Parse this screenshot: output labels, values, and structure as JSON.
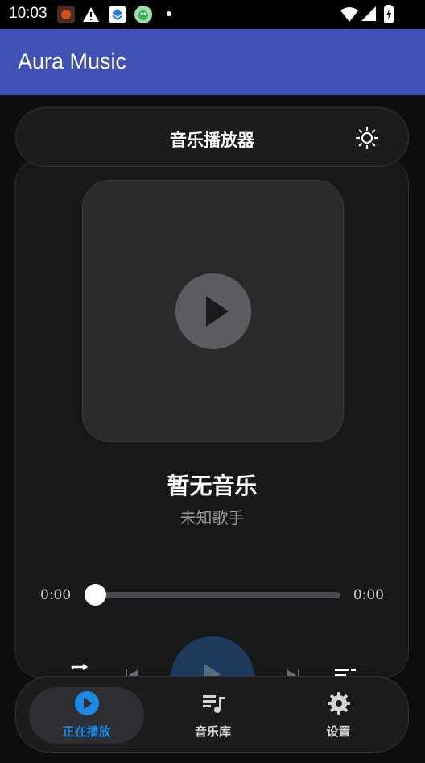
{
  "status_bar": {
    "time": "10:03"
  },
  "app_bar": {
    "title": "Aura Music"
  },
  "header": {
    "title": "音乐播放器",
    "theme_icon": "sun-icon"
  },
  "player": {
    "song_title": "暂无音乐",
    "artist": "未知歌手",
    "time_current": "0:00",
    "time_total": "0:00",
    "progress": 0
  },
  "controls": {
    "repeat_icon": "repeat-icon",
    "prev_icon": "skip-previous-icon",
    "play_icon": "play-icon",
    "next_icon": "skip-next-icon",
    "queue_icon": "queue-music-icon"
  },
  "bottom_nav": {
    "items": [
      {
        "label": "正在播放",
        "icon": "play-circle-icon",
        "active": true
      },
      {
        "label": "音乐库",
        "icon": "library-music-icon",
        "active": false
      },
      {
        "label": "设置",
        "icon": "gear-icon",
        "active": false
      }
    ]
  },
  "colors": {
    "app_bar": "#3f51b5",
    "accent": "#1e88e5",
    "background": "#0e0e10"
  }
}
